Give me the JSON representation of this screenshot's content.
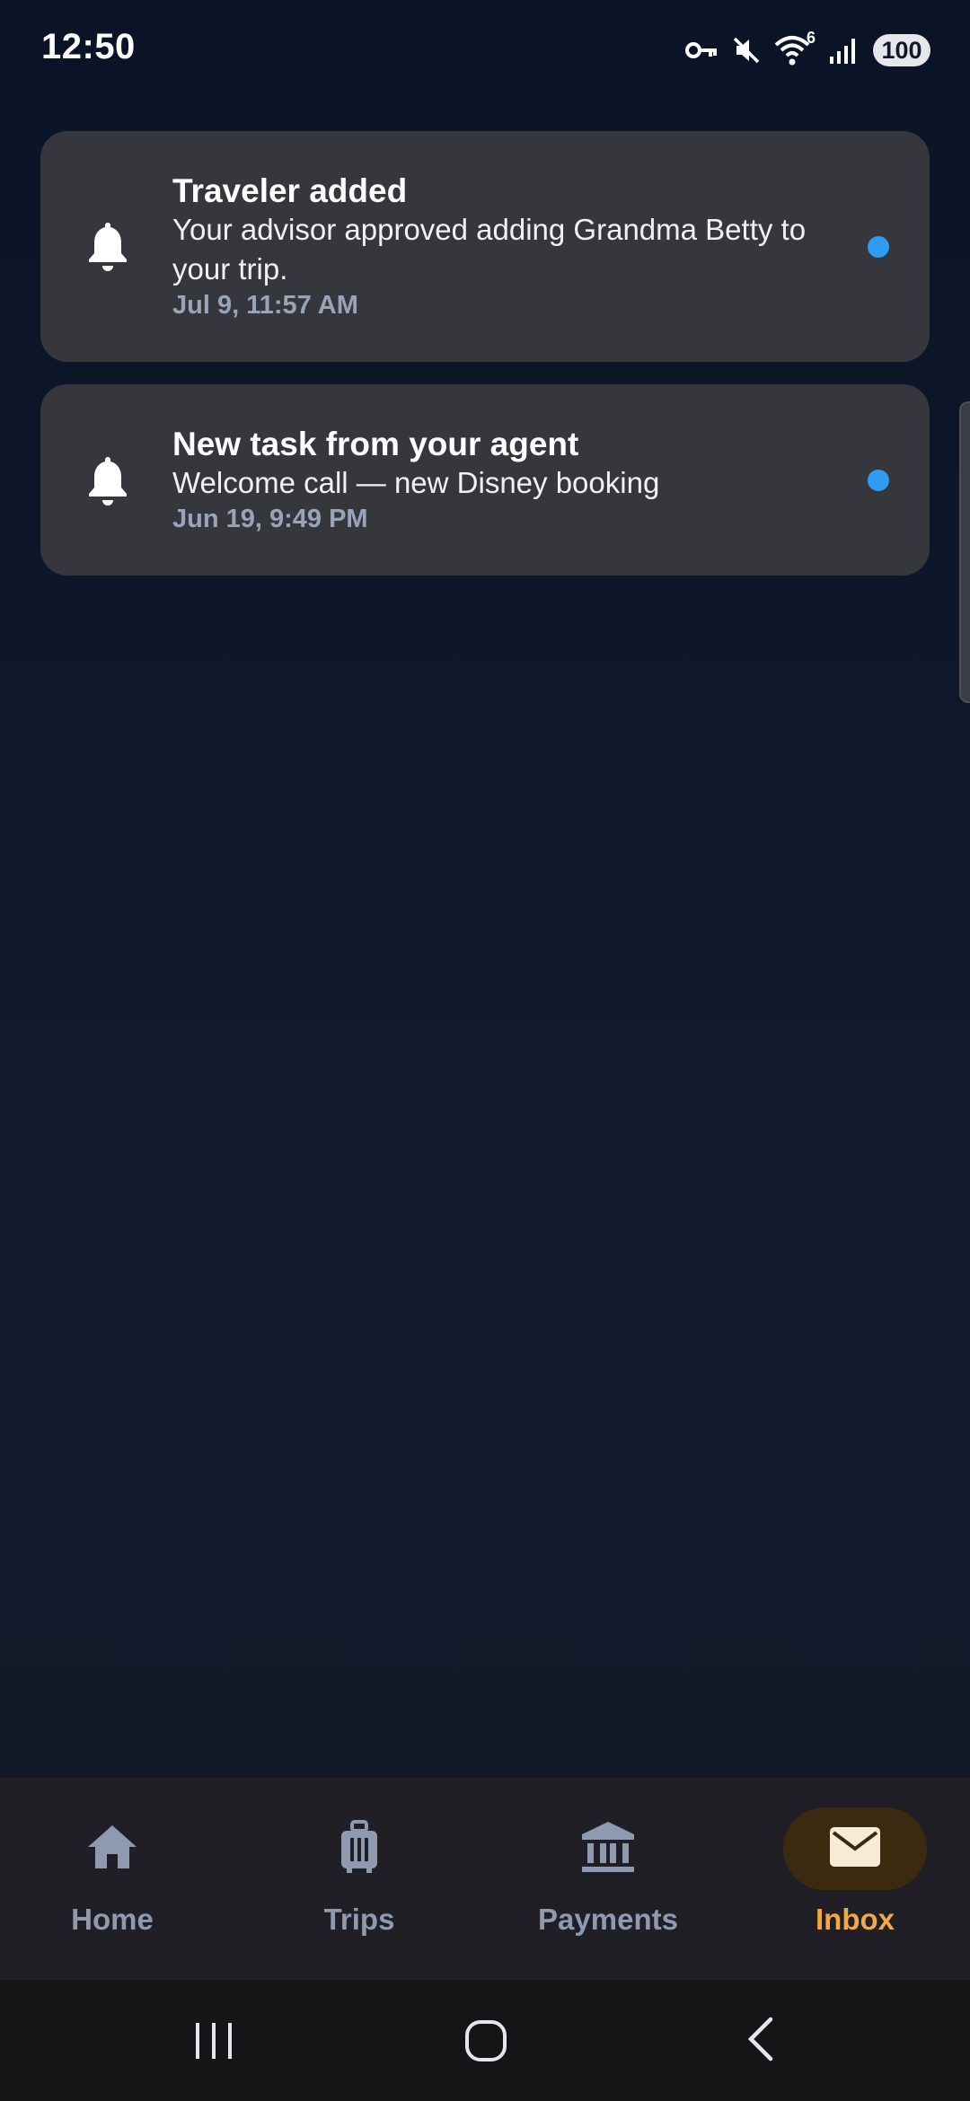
{
  "status_bar": {
    "time": "12:50",
    "wifi_badge": "6",
    "battery": "100",
    "icons": [
      "vpn-key-icon",
      "mute-icon",
      "wifi-icon",
      "signal-icon",
      "battery-icon"
    ]
  },
  "notifications": [
    {
      "icon": "bell-icon",
      "title": "Traveler added",
      "body": "Your advisor approved adding Grandma Betty to your trip.",
      "time": "Jul 9, 11:57 AM",
      "unread": true
    },
    {
      "icon": "bell-icon",
      "title": "New task from your agent",
      "body": "Welcome call — new Disney booking",
      "time": "Jun 19, 9:49 PM",
      "unread": true
    }
  ],
  "bottom_nav": {
    "items": [
      {
        "label": "Home",
        "icon": "home-icon",
        "active": false
      },
      {
        "label": "Trips",
        "icon": "suitcase-icon",
        "active": false
      },
      {
        "label": "Payments",
        "icon": "bank-icon",
        "active": false
      },
      {
        "label": "Inbox",
        "icon": "envelope-icon",
        "active": true
      }
    ]
  },
  "colors": {
    "background": "#111a2c",
    "card": "#36363d",
    "unread_dot": "#2e9cf0",
    "active_nav": "#f0a84a",
    "inactive_nav": "#8f9ab0"
  }
}
